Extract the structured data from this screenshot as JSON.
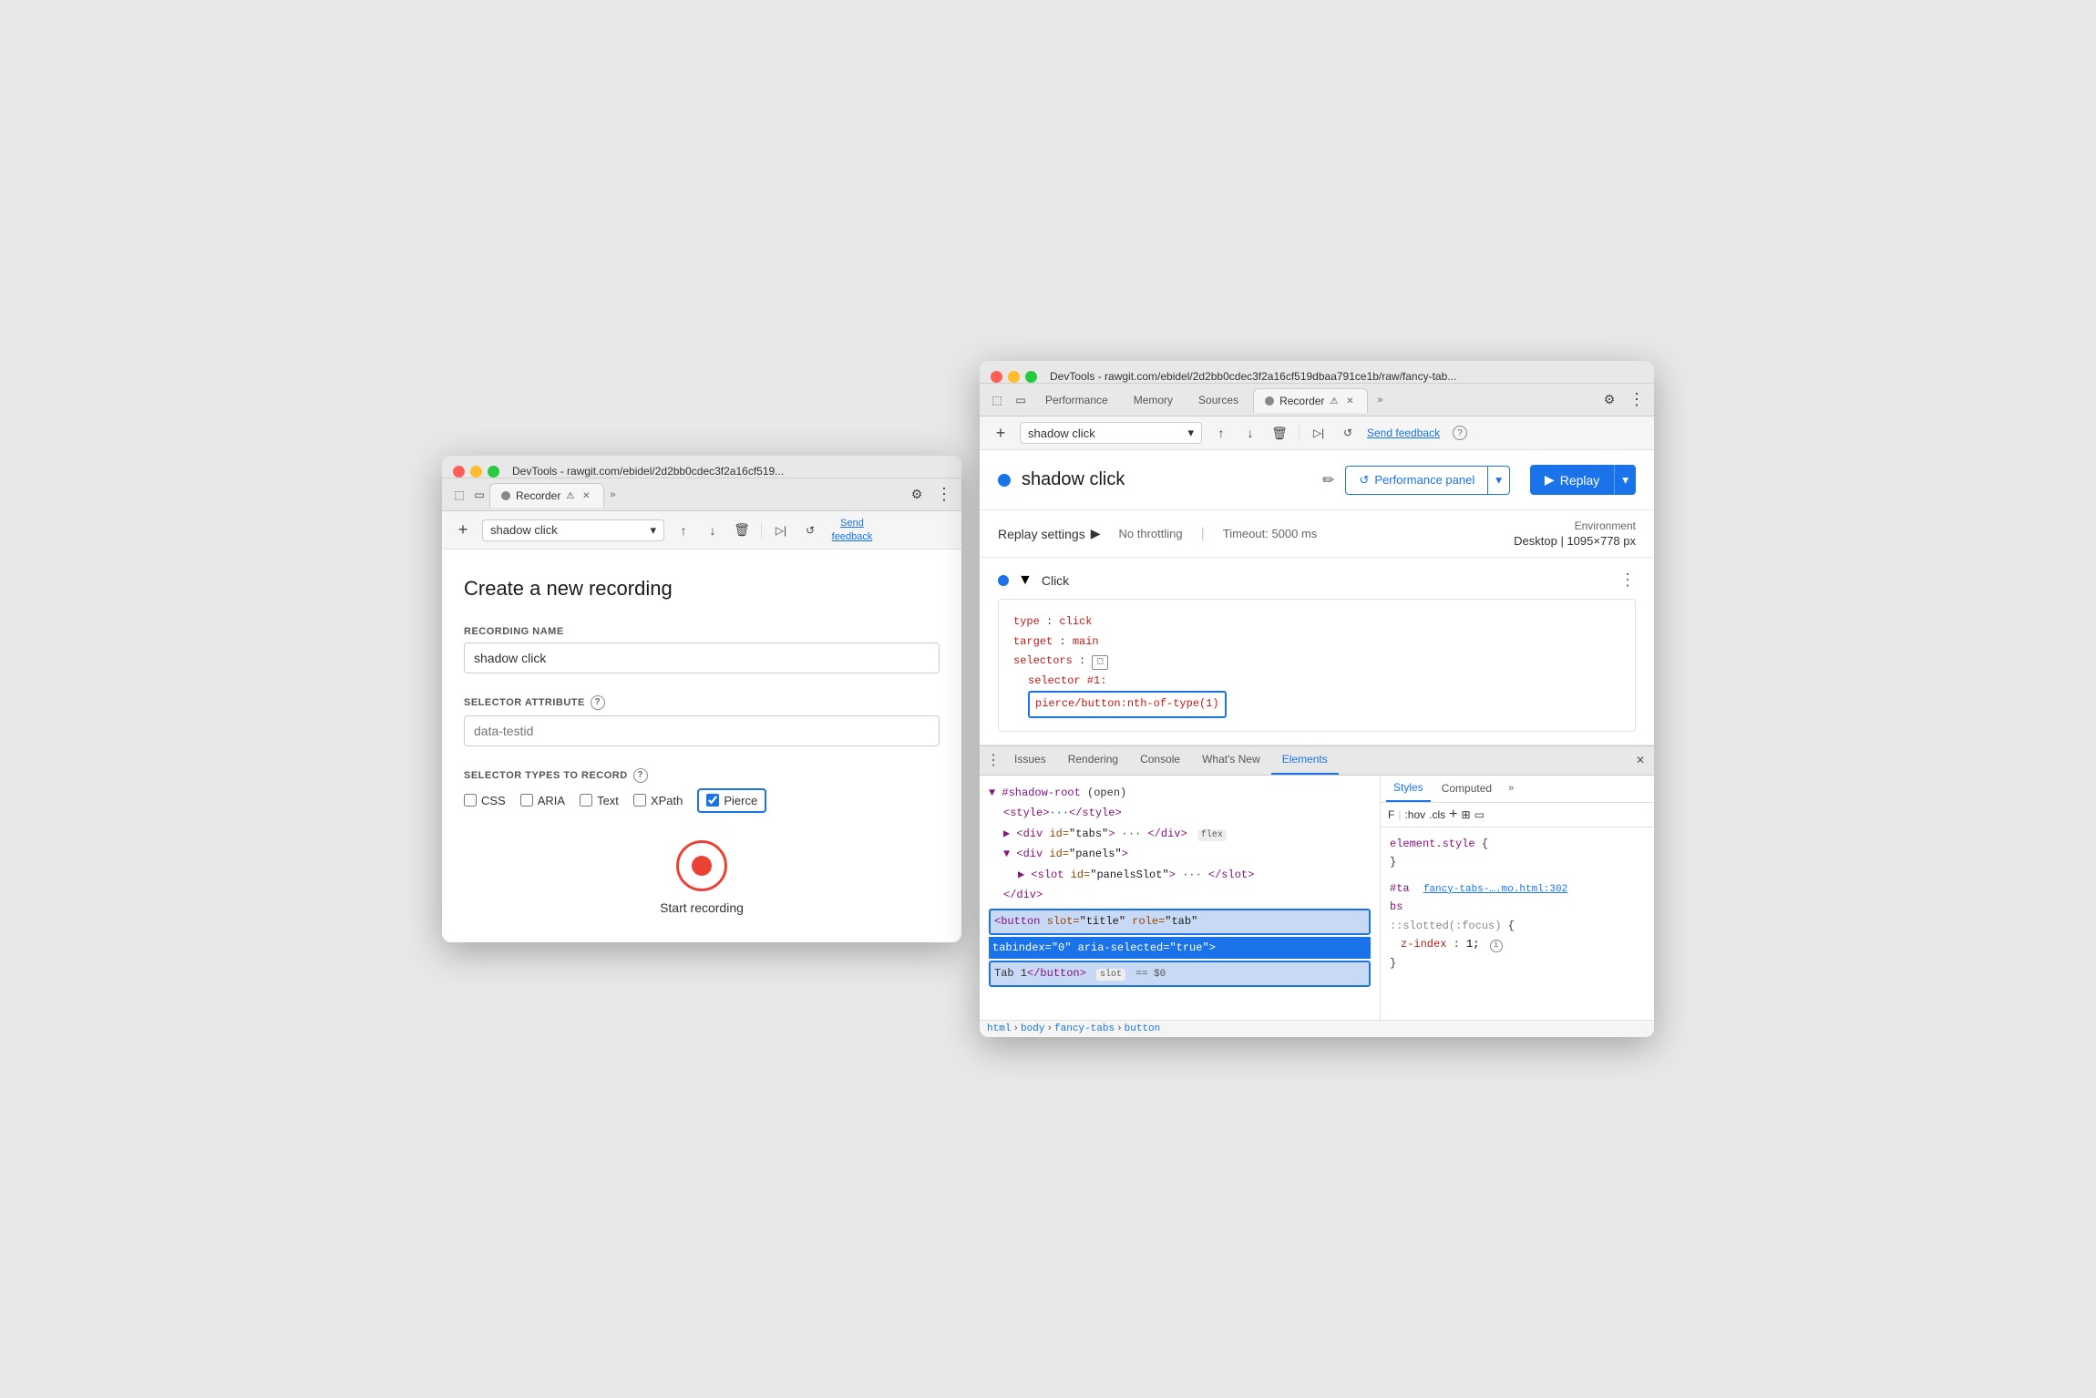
{
  "windows": {
    "left": {
      "title": "DevTools - rawgit.com/ebidel/2d2bb0cdec3f2a16cf519...",
      "tab_label": "Recorder",
      "tab_icon": "record",
      "toolbar": {
        "new_icon": "+",
        "recording_name": "shadow click",
        "upload_label": "upload",
        "download_label": "download",
        "delete_label": "delete",
        "step_icon": "step",
        "replay_icon": "replay",
        "send_feedback": "Send\nfeedback",
        "settings_label": "settings",
        "more_label": "more"
      },
      "form": {
        "title": "Create a new recording",
        "recording_name_label": "RECORDING NAME",
        "recording_name_value": "shadow click",
        "selector_attr_label": "SELECTOR ATTRIBUTE",
        "selector_attr_placeholder": "data-testid",
        "selector_types_label": "SELECTOR TYPES TO RECORD",
        "css_label": "CSS",
        "aria_label": "ARIA",
        "text_label": "Text",
        "xpath_label": "XPath",
        "pierce_label": "Pierce",
        "css_checked": false,
        "aria_checked": false,
        "text_checked": false,
        "xpath_checked": false,
        "pierce_checked": true,
        "start_recording_label": "Start recording"
      }
    },
    "right": {
      "title": "DevTools - rawgit.com/ebidel/2d2bb0cdec3f2a16cf519dbaa791ce1b/raw/fancy-tab...",
      "nav_tabs": [
        "Performance",
        "Memory",
        "Sources",
        "Recorder"
      ],
      "active_tab": "Recorder",
      "toolbar": {
        "new_icon": "+",
        "recording_name": "shadow click",
        "upload_label": "upload",
        "download_label": "download",
        "delete_label": "delete",
        "step_icon": "step",
        "replay_icon": "replay",
        "send_feedback": "Send feedback",
        "help_label": "help"
      },
      "recording": {
        "name": "shadow click",
        "dot_color": "#1a73e8",
        "performance_panel_label": "Performance panel",
        "replay_label": "Replay"
      },
      "replay_settings": {
        "title": "Replay settings",
        "throttling": "No throttling",
        "timeout": "Timeout: 5000 ms",
        "environment_label": "Environment",
        "environment_value": "Desktop",
        "resolution": "1095×778 px"
      },
      "click_step": {
        "label": "Click",
        "type_key": "type",
        "type_val": "click",
        "target_key": "target",
        "target_val": "main",
        "selectors_key": "selectors",
        "selector_num_label": "selector #1:",
        "selector_value": "pierce/button:nth-of-type(1)"
      },
      "devtools_tabs": [
        "Issues",
        "Rendering",
        "Console",
        "What's New",
        "Elements"
      ],
      "active_devtools_tab": "Elements",
      "dom": {
        "shadow_root": "▼ #shadow-root",
        "open_label": "(open)",
        "style_tag": "▶ <style>···</style>",
        "div_tabs": "▶ <div id=\"tabs\">···</div>",
        "flex_badge": "flex",
        "div_panels": "▼ <div id=\"panels\">",
        "slot_panels": "▶ <slot id=\"panelsSlot\">···</slot>",
        "div_close": "</div>",
        "button_selected": "<button slot=\"title\" role=\"tab\"\n  tabindex=\"0\" aria-selected=\"true\">\n  Tab 1</button>",
        "slot_badge": "slot",
        "dollar_badge": "== $0"
      },
      "breadcrumb": [
        "html",
        "body",
        "fancy-tabs",
        "button"
      ],
      "styles": {
        "filter_placeholder": "F",
        "hov_label": ":hov",
        "cls_label": ".cls",
        "rule1": "element.style {",
        "rule1_close": "}",
        "rule2_selector": "#ta",
        "rule2_source": "fancy-tabs-….mo.html:302",
        "rule2_sub": "bs",
        "rule2_pseudo": "::slotted(:focus)",
        "rule2_prop": "z-index",
        "rule2_val": "1",
        "rule2_close": "}"
      }
    }
  }
}
